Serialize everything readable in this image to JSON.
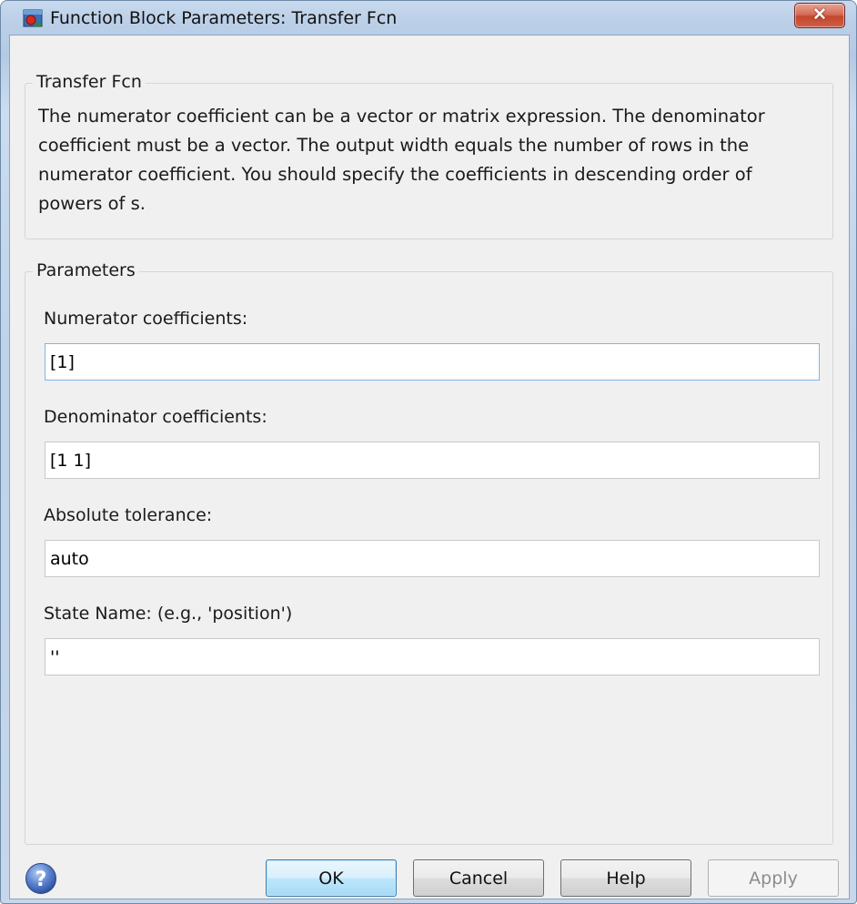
{
  "window": {
    "title": "Function Block Parameters: Transfer Fcn",
    "close_glyph": "✕"
  },
  "block_group": {
    "legend": "Transfer Fcn",
    "description": "The numerator coefficient can be a vector or matrix expression. The denominator coefficient must be a vector. The output width equals the number of rows in the numerator coefficient. You should specify the coefficients in descending order of powers of s."
  },
  "parameters_group": {
    "legend": "Parameters",
    "fields": [
      {
        "label": "Numerator coefficients:",
        "value": "[1]"
      },
      {
        "label": "Denominator coefficients:",
        "value": "[1 1]"
      },
      {
        "label": "Absolute tolerance:",
        "value": "auto"
      },
      {
        "label": "State Name: (e.g., 'position')",
        "value": "''"
      }
    ]
  },
  "buttons": {
    "ok": "OK",
    "cancel": "Cancel",
    "help": "Help",
    "apply": "Apply"
  },
  "icons": {
    "app": "simulink-block-icon",
    "help": "help-question-icon",
    "close": "close-icon"
  },
  "colors": {
    "window_frame": "#bcd0e8",
    "close_button": "#c2462c",
    "default_button_border": "#3c7fb1",
    "focused_input_border": "#7eb4ea"
  }
}
